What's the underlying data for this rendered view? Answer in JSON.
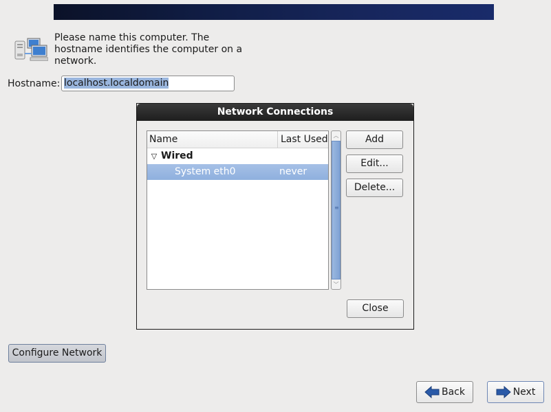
{
  "header": {
    "banner_color": "#17265c"
  },
  "intro": {
    "text": "Please name this computer.  The hostname identifies the computer on a network."
  },
  "hostname": {
    "label": "Hostname:",
    "value": "localhost.localdomain"
  },
  "dialog": {
    "title": "Network Connections",
    "columns": [
      "Name",
      "Last Used"
    ],
    "groups": [
      {
        "label": "Wired",
        "items": [
          {
            "name": "System eth0",
            "last_used": "never",
            "selected": true
          }
        ]
      }
    ],
    "buttons": {
      "add": "Add",
      "edit": "Edit...",
      "delete": "Delete...",
      "close": "Close"
    }
  },
  "configure_network": "Configure Network",
  "nav": {
    "back": "Back",
    "next": "Next"
  },
  "colors": {
    "selection": "#9ab6de",
    "arrow_blue": "#2a5aa8"
  }
}
